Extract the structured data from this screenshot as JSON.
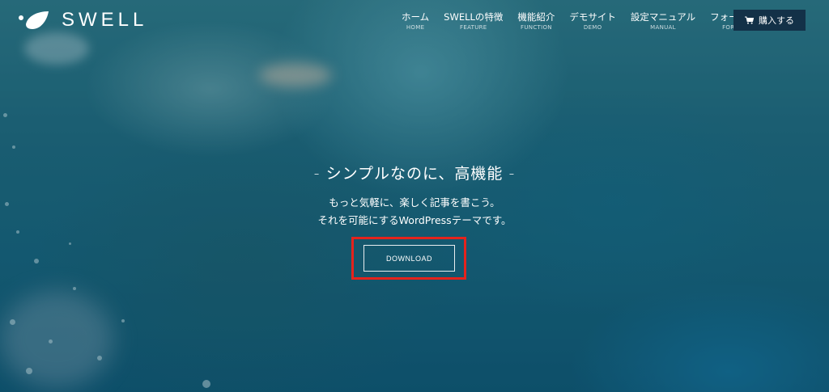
{
  "site": {
    "logo_text": "SWELL"
  },
  "nav": [
    {
      "label": "ホーム",
      "sub": "HOME"
    },
    {
      "label": "SWELLの特徴",
      "sub": "FEATURE"
    },
    {
      "label": "機能紹介",
      "sub": "FUNCTION"
    },
    {
      "label": "デモサイト",
      "sub": "DEMO"
    },
    {
      "label": "設定マニュアル",
      "sub": "MANUAL"
    },
    {
      "label": "フォーラム",
      "sub": "FORUM"
    }
  ],
  "buy_button": {
    "label": "購入する",
    "icon": "cart-icon"
  },
  "hero": {
    "tagline": "- シンプルなのに、高機能 -",
    "description_line1": "もっと気軽に、楽しく記事を書こう。",
    "description_line2": "それを可能にするWordPressテーマです。",
    "download_label": "DOWNLOAD"
  },
  "colors": {
    "buy_button_bg": "#133148",
    "highlight_border": "#e5231c",
    "water_base": "#176680"
  }
}
